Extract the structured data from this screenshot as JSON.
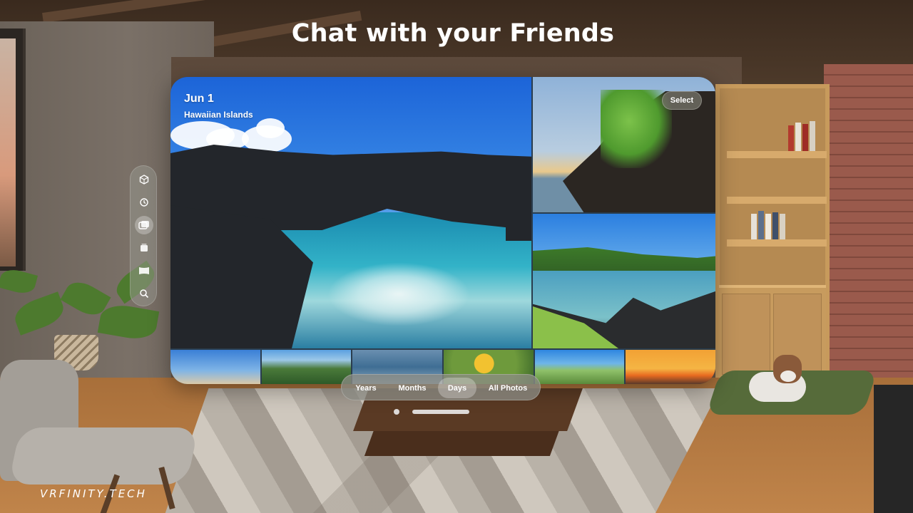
{
  "headline": "Chat with your Friends",
  "watermark": "VRFINITY.TECH",
  "sidebar": {
    "items": [
      {
        "icon": "spatial-icon"
      },
      {
        "icon": "memories-icon"
      },
      {
        "icon": "library-icon",
        "active": true
      },
      {
        "icon": "albums-icon"
      },
      {
        "icon": "panoramas-icon"
      },
      {
        "icon": "search-icon"
      }
    ]
  },
  "photos": {
    "featured": {
      "date": "Jun 1",
      "location": "Hawaiian Islands"
    },
    "select_label": "Select"
  },
  "view_tabs": {
    "items": [
      {
        "label": "Years"
      },
      {
        "label": "Months"
      },
      {
        "label": "Days",
        "active": true
      },
      {
        "label": "All Photos"
      }
    ]
  },
  "colors": {
    "accent_text": "#ffffff",
    "glass": "#8c8c84"
  }
}
